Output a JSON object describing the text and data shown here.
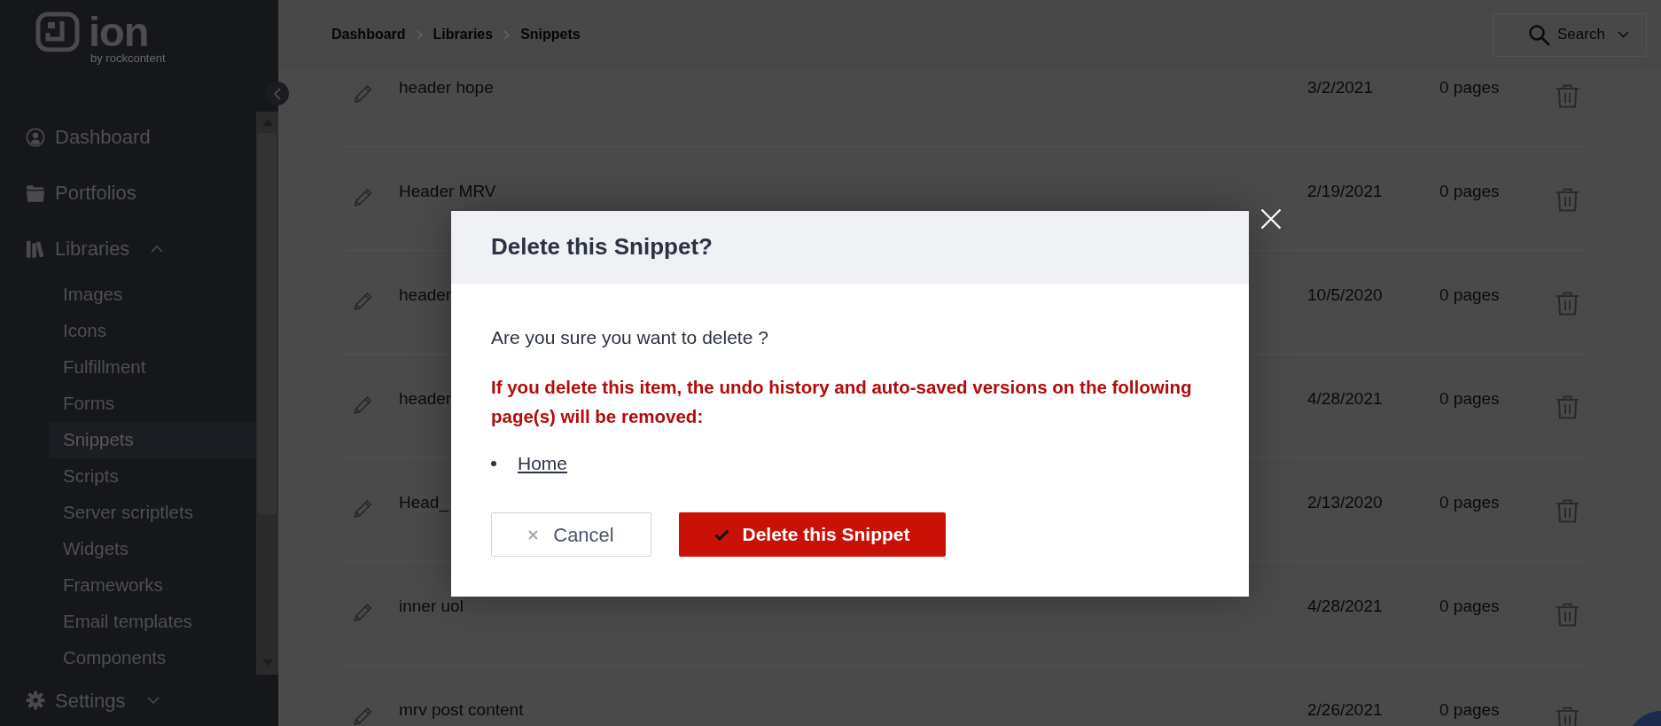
{
  "logo": {
    "wordmark": "ion",
    "tagline": "by rockcontent"
  },
  "sidebar": {
    "items": [
      {
        "label": "Dashboard",
        "kind": "link"
      },
      {
        "label": "Portfolios",
        "kind": "link"
      },
      {
        "label": "Libraries",
        "kind": "group",
        "expanded": true,
        "children": [
          {
            "label": "Images",
            "selected": false
          },
          {
            "label": "Icons",
            "selected": false
          },
          {
            "label": "Fulfillment",
            "selected": false
          },
          {
            "label": "Forms",
            "selected": false
          },
          {
            "label": "Snippets",
            "selected": true
          },
          {
            "label": "Scripts",
            "selected": false
          },
          {
            "label": "Server scriptlets",
            "selected": false
          },
          {
            "label": "Widgets",
            "selected": false
          },
          {
            "label": "Frameworks",
            "selected": false
          },
          {
            "label": "Email templates",
            "selected": false
          },
          {
            "label": "Components",
            "selected": false
          }
        ]
      }
    ],
    "footer_item": {
      "label": "Settings",
      "expanded": false
    }
  },
  "breadcrumb": [
    "Dashboard",
    "Libraries",
    "Snippets"
  ],
  "search": {
    "label": "Search"
  },
  "snippets": [
    {
      "name": "header hope",
      "date": "3/2/2021",
      "pages": "0 pages"
    },
    {
      "name": "Header MRV",
      "date": "2/19/2021",
      "pages": "0 pages"
    },
    {
      "name": "header",
      "date": "10/5/2020",
      "pages": "0 pages"
    },
    {
      "name": "header",
      "date": "4/28/2021",
      "pages": "0 pages"
    },
    {
      "name": "Head_",
      "date": "2/13/2020",
      "pages": "0 pages"
    },
    {
      "name": "inner uol",
      "date": "4/28/2021",
      "pages": "0 pages"
    },
    {
      "name": "mrv post content",
      "date": "2/26/2021",
      "pages": "0 pages"
    }
  ],
  "dialog": {
    "title": "Delete this Snippet?",
    "message": "Are you sure you want to delete ?",
    "warning": "If you delete this item, the undo history and auto-saved versions on the following page(s) will be removed:",
    "pages": [
      "Home"
    ],
    "buttons": [
      {
        "label": "Cancel",
        "kind": "cancel"
      },
      {
        "label": "Delete this Snippet",
        "kind": "confirm"
      }
    ]
  }
}
